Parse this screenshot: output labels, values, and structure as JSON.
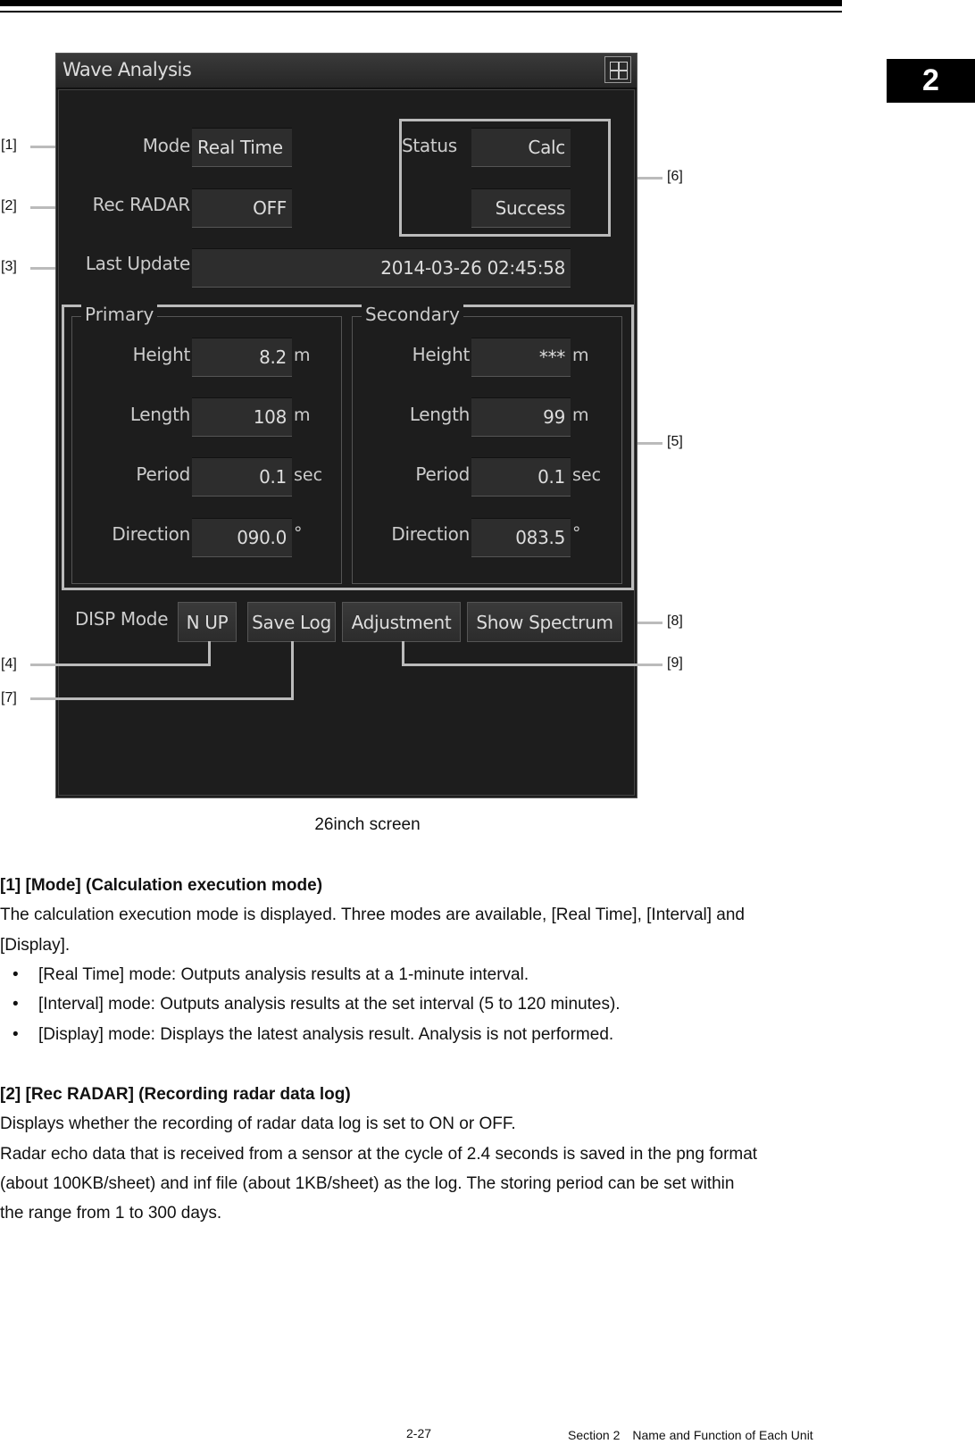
{
  "chapter": "2",
  "window": {
    "title": "Wave Analysis",
    "icon": "layout-grid-icon",
    "mode": {
      "label": "Mode",
      "value": "Real Time"
    },
    "rec_radar": {
      "label": "Rec RADAR",
      "value": "OFF"
    },
    "last_update": {
      "label": "Last Update",
      "value": "2014-03-26 02:45:58"
    },
    "status": {
      "label": "Status",
      "value": "Calc",
      "result": "Success"
    },
    "primary": {
      "title": "Primary",
      "rows": [
        {
          "label": "Height",
          "value": "8.2",
          "unit": "m"
        },
        {
          "label": "Length",
          "value": "108",
          "unit": "m"
        },
        {
          "label": "Period",
          "value": "0.1",
          "unit": "sec"
        },
        {
          "label": "Direction",
          "value": "090.0",
          "unit": "°"
        }
      ]
    },
    "secondary": {
      "title": "Secondary",
      "rows": [
        {
          "label": "Height",
          "value": "***",
          "unit": "m"
        },
        {
          "label": "Length",
          "value": "99",
          "unit": "m"
        },
        {
          "label": "Period",
          "value": "0.1",
          "unit": "sec"
        },
        {
          "label": "Direction",
          "value": "083.5",
          "unit": "°"
        }
      ]
    },
    "disp_mode": {
      "label": "DISP Mode",
      "value": "N UP"
    },
    "buttons": {
      "save_log": "Save Log",
      "adjustment": "Adjustment",
      "show_spectrum": "Show Spectrum"
    }
  },
  "callouts": {
    "c1": "[1]",
    "c2": "[2]",
    "c3": "[3]",
    "c4": "[4]",
    "c5": "[5]",
    "c6": "[6]",
    "c7": "[7]",
    "c8": "[8]",
    "c9": "[9]"
  },
  "caption": "26inch screen",
  "body": {
    "h1": "[1] [Mode] (Calculation execution mode)",
    "p1a": "The calculation execution mode is displayed. Three modes are available, [Real Time], [Interval] and",
    "p1b": "[Display].",
    "bullets": [
      "[Real Time] mode: Outputs analysis results at a 1-minute interval.",
      "[Interval] mode: Outputs analysis results at the set interval (5 to 120 minutes).",
      "[Display] mode: Displays the latest analysis result. Analysis is not performed."
    ],
    "h2": "[2] [Rec RADAR] (Recording radar data log)",
    "p2a": "Displays whether the recording of radar data log is set to ON or OFF.",
    "p2b": "Radar echo data that is received from a sensor at the cycle of 2.4 seconds is saved in the png format",
    "p2c": "(about 100KB/sheet) and inf file (about 1KB/sheet) as the log. The storing period can be set within",
    "p2d": "the range from 1 to 300 days."
  },
  "footer": {
    "page": "2-27",
    "section": "Section 2　Name and Function of Each Unit"
  }
}
